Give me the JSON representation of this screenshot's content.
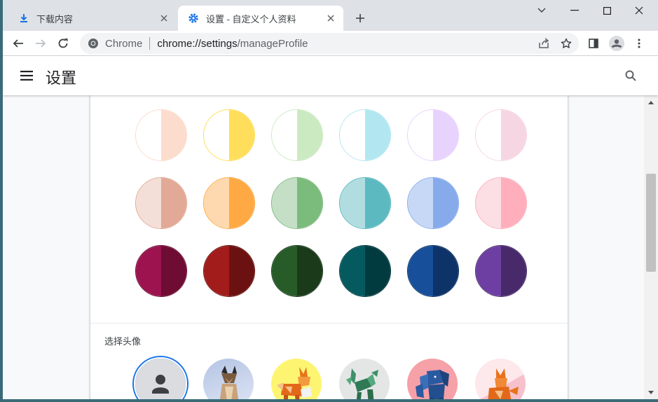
{
  "tabs": [
    {
      "title": "下载内容",
      "icon": "download-icon",
      "active": false
    },
    {
      "title": "设置 - 自定义个人资料",
      "icon": "gear-icon",
      "active": true
    }
  ],
  "toolbar": {
    "site_chip": "Chrome",
    "url_host": "chrome://settings",
    "url_path": "/manageProfile"
  },
  "settings": {
    "title": "设置"
  },
  "theme_colors": [
    [
      [
        "#ffffff",
        "#fcdccd"
      ],
      [
        "#ffffff",
        "#ffde5b"
      ],
      [
        "#ffffff",
        "#cceac1"
      ],
      [
        "#ffffff",
        "#b2e7f1"
      ],
      [
        "#ffffff",
        "#e8d2fe"
      ],
      [
        "#ffffff",
        "#f6d6e3"
      ]
    ],
    [
      [
        "#f3dfd8",
        "#e2a996"
      ],
      [
        "#fed9af",
        "#ffa944"
      ],
      [
        "#c4dfc6",
        "#7bbb7c"
      ],
      [
        "#b1dde0",
        "#5cb9c0"
      ],
      [
        "#c6d8f6",
        "#87aaeb"
      ],
      [
        "#fcdee5",
        "#ffaebb"
      ]
    ],
    [
      [
        "#9d1350",
        "#6e0c33"
      ],
      [
        "#a21c1c",
        "#6b1111"
      ],
      [
        "#275c29",
        "#1a3a1a"
      ],
      [
        "#045a5f",
        "#023b3f"
      ],
      [
        "#174f9a",
        "#0d3368"
      ],
      [
        "#6e3fa2",
        "#482a6b"
      ]
    ]
  ],
  "avatar_section": {
    "label": "选择头像",
    "avatars": [
      "default-person-avatar",
      "origami-cat-avatar",
      "origami-fox-avatar",
      "origami-dragon-avatar",
      "origami-elephant-avatar",
      "origami-fox-pink-avatar"
    ]
  },
  "colors": {
    "accent": "#1a73e8",
    "tab_strip": "#dee1e6"
  }
}
